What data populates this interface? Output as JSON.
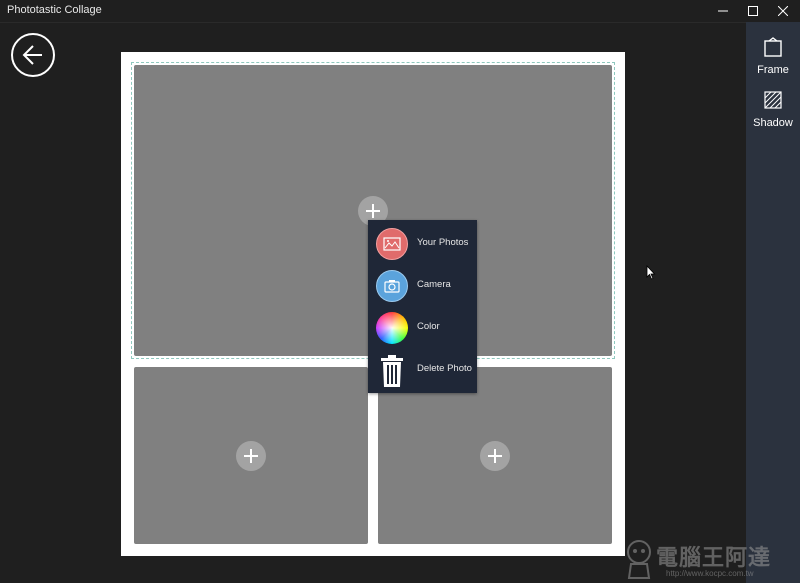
{
  "app": {
    "title": "Phototastic Collage"
  },
  "sidebar": {
    "items": [
      {
        "label": "Frame",
        "icon": "frame-icon"
      },
      {
        "label": "Shadow",
        "icon": "shadow-icon"
      }
    ]
  },
  "context_menu": {
    "items": [
      {
        "label": "Your Photos",
        "icon": "your-photos-icon",
        "color": "#e06b6b"
      },
      {
        "label": "Camera",
        "icon": "camera-icon",
        "color": "#5ba3dc"
      },
      {
        "label": "Color",
        "icon": "color-wheel-icon"
      },
      {
        "label": "Delete Photo",
        "icon": "trash-icon"
      }
    ]
  },
  "watermark": {
    "text": "電腦王阿達",
    "url": "http://www.kocpc.com.tw"
  },
  "colors": {
    "background": "#1f1f1f",
    "sidebar": "#2b323e",
    "menu": "#1f2737",
    "cell": "#808080"
  }
}
